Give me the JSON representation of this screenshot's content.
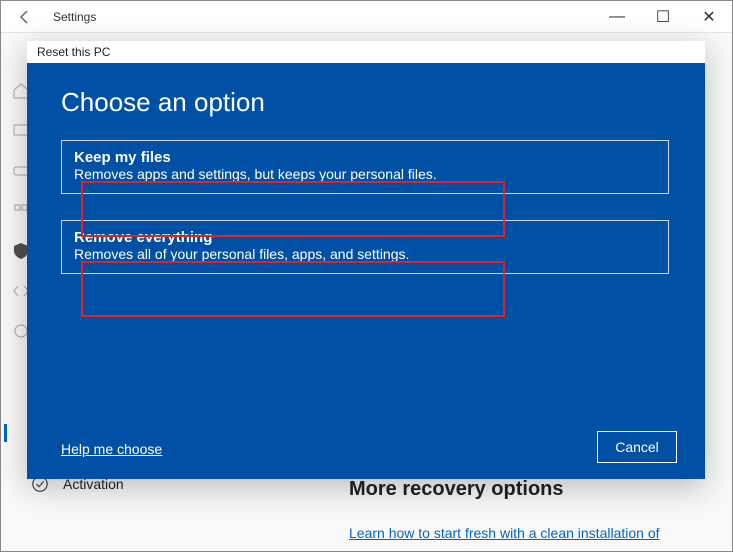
{
  "window": {
    "title": "Settings",
    "controls": {
      "min": "—",
      "max": "☐",
      "close": "✕"
    }
  },
  "dialog": {
    "title": "Reset this PC",
    "heading": "Choose an option",
    "options": [
      {
        "title": "Keep my files",
        "desc": "Removes apps and settings, but keeps your personal files."
      },
      {
        "title": "Remove everything",
        "desc": "Removes all of your personal files, apps, and settings."
      }
    ],
    "help": "Help me choose",
    "cancel": "Cancel"
  },
  "background": {
    "activation": "Activation",
    "rightTitle": "More recovery options",
    "rightLink": "Learn how to start fresh with a clean installation of"
  }
}
